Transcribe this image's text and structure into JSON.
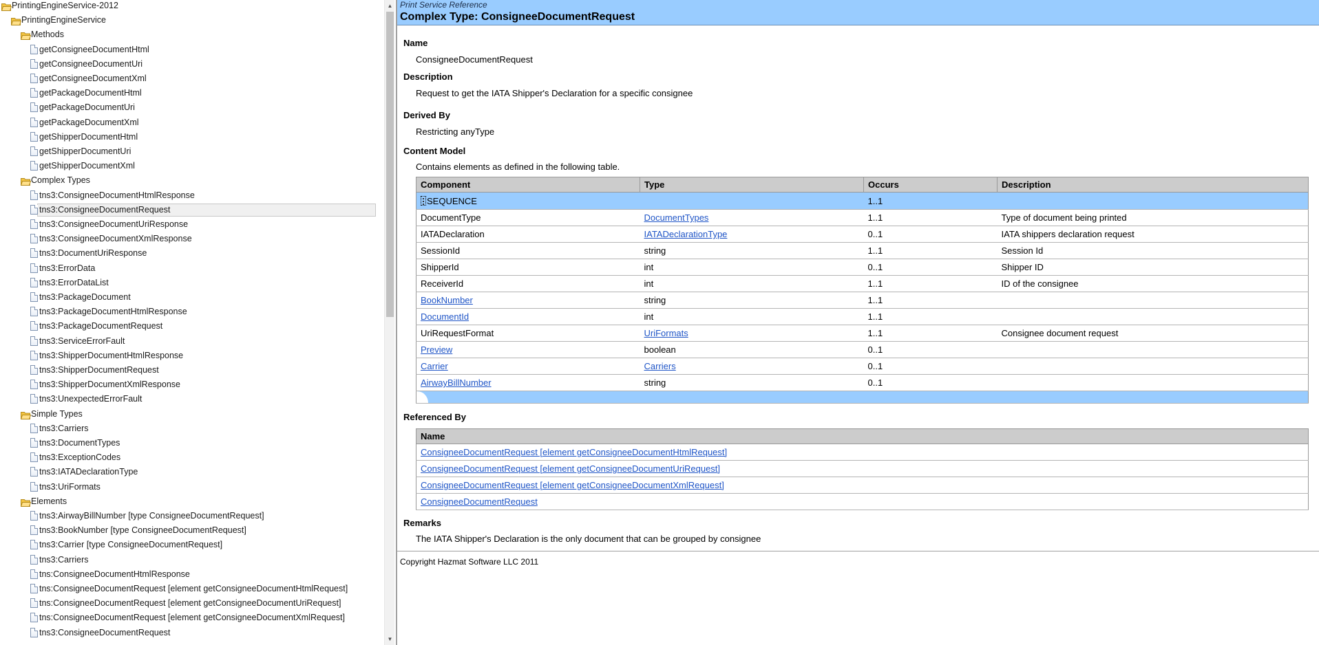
{
  "tree": {
    "items": [
      {
        "depth": 0,
        "kind": "folder",
        "label": "PrintingEngineService-2012"
      },
      {
        "depth": 1,
        "kind": "folder",
        "label": "PrintingEngineService"
      },
      {
        "depth": 2,
        "kind": "folder",
        "label": "Methods"
      },
      {
        "depth": 3,
        "kind": "doc",
        "label": "getConsigneeDocumentHtml"
      },
      {
        "depth": 3,
        "kind": "doc",
        "label": "getConsigneeDocumentUri"
      },
      {
        "depth": 3,
        "kind": "doc",
        "label": "getConsigneeDocumentXml"
      },
      {
        "depth": 3,
        "kind": "doc",
        "label": "getPackageDocumentHtml"
      },
      {
        "depth": 3,
        "kind": "doc",
        "label": "getPackageDocumentUri"
      },
      {
        "depth": 3,
        "kind": "doc",
        "label": "getPackageDocumentXml"
      },
      {
        "depth": 3,
        "kind": "doc",
        "label": "getShipperDocumentHtml"
      },
      {
        "depth": 3,
        "kind": "doc",
        "label": "getShipperDocumentUri"
      },
      {
        "depth": 3,
        "kind": "doc",
        "label": "getShipperDocumentXml"
      },
      {
        "depth": 2,
        "kind": "folder",
        "label": "Complex Types"
      },
      {
        "depth": 3,
        "kind": "doc",
        "label": "tns3:ConsigneeDocumentHtmlResponse"
      },
      {
        "depth": 3,
        "kind": "doc",
        "label": "tns3:ConsigneeDocumentRequest",
        "selected": true
      },
      {
        "depth": 3,
        "kind": "doc",
        "label": "tns3:ConsigneeDocumentUriResponse"
      },
      {
        "depth": 3,
        "kind": "doc",
        "label": "tns3:ConsigneeDocumentXmlResponse"
      },
      {
        "depth": 3,
        "kind": "doc",
        "label": "tns3:DocumentUriResponse"
      },
      {
        "depth": 3,
        "kind": "doc",
        "label": "tns3:ErrorData"
      },
      {
        "depth": 3,
        "kind": "doc",
        "label": "tns3:ErrorDataList"
      },
      {
        "depth": 3,
        "kind": "doc",
        "label": "tns3:PackageDocument"
      },
      {
        "depth": 3,
        "kind": "doc",
        "label": "tns3:PackageDocumentHtmlResponse"
      },
      {
        "depth": 3,
        "kind": "doc",
        "label": "tns3:PackageDocumentRequest"
      },
      {
        "depth": 3,
        "kind": "doc",
        "label": "tns3:ServiceErrorFault"
      },
      {
        "depth": 3,
        "kind": "doc",
        "label": "tns3:ShipperDocumentHtmlResponse"
      },
      {
        "depth": 3,
        "kind": "doc",
        "label": "tns3:ShipperDocumentRequest"
      },
      {
        "depth": 3,
        "kind": "doc",
        "label": "tns3:ShipperDocumentXmlResponse"
      },
      {
        "depth": 3,
        "kind": "doc",
        "label": "tns3:UnexpectedErrorFault"
      },
      {
        "depth": 2,
        "kind": "folder",
        "label": "Simple Types"
      },
      {
        "depth": 3,
        "kind": "doc",
        "label": "tns3:Carriers"
      },
      {
        "depth": 3,
        "kind": "doc",
        "label": "tns3:DocumentTypes"
      },
      {
        "depth": 3,
        "kind": "doc",
        "label": "tns3:ExceptionCodes"
      },
      {
        "depth": 3,
        "kind": "doc",
        "label": "tns3:IATADeclarationType"
      },
      {
        "depth": 3,
        "kind": "doc",
        "label": "tns3:UriFormats"
      },
      {
        "depth": 2,
        "kind": "folder",
        "label": "Elements"
      },
      {
        "depth": 3,
        "kind": "doc",
        "label": "tns3:AirwayBillNumber [type ConsigneeDocumentRequest]"
      },
      {
        "depth": 3,
        "kind": "doc",
        "label": "tns3:BookNumber [type ConsigneeDocumentRequest]"
      },
      {
        "depth": 3,
        "kind": "doc",
        "label": "tns3:Carrier [type ConsigneeDocumentRequest]"
      },
      {
        "depth": 3,
        "kind": "doc",
        "label": "tns3:Carriers"
      },
      {
        "depth": 3,
        "kind": "doc",
        "label": "tns:ConsigneeDocumentHtmlResponse"
      },
      {
        "depth": 3,
        "kind": "doc",
        "label": "tns:ConsigneeDocumentRequest [element getConsigneeDocumentHtmlRequest]"
      },
      {
        "depth": 3,
        "kind": "doc",
        "label": "tns:ConsigneeDocumentRequest [element getConsigneeDocumentUriRequest]"
      },
      {
        "depth": 3,
        "kind": "doc",
        "label": "tns:ConsigneeDocumentRequest [element getConsigneeDocumentXmlRequest]"
      },
      {
        "depth": 3,
        "kind": "doc",
        "label": "tns3:ConsigneeDocumentRequest"
      }
    ]
  },
  "header": {
    "eyebrow": "Print Service Reference",
    "title": "Complex Type: ConsigneeDocumentRequest"
  },
  "sections": {
    "name_heading": "Name",
    "name_value": "ConsigneeDocumentRequest",
    "description_heading": "Description",
    "description_value": "Request to get the IATA Shipper's Declaration for a specific consignee",
    "derived_heading": "Derived By",
    "derived_value": "Restricting anyType",
    "content_model_heading": "Content Model",
    "content_model_intro": "Contains elements as defined in the following table.",
    "referenced_by_heading": "Referenced By",
    "remarks_heading": "Remarks",
    "remarks_value": "The IATA Shipper's Declaration is the only document that can be grouped by consignee"
  },
  "content_model": {
    "columns": [
      "Component",
      "Type",
      "Occurs",
      "Description"
    ],
    "group": {
      "label": "SEQUENCE",
      "occurs": "1..1"
    },
    "rows": [
      {
        "component": "DocumentType",
        "component_link": false,
        "type": "DocumentTypes",
        "type_link": true,
        "occurs": "1..1",
        "description": "Type of document being printed"
      },
      {
        "component": "IATADeclaration",
        "component_link": false,
        "type": "IATADeclarationType",
        "type_link": true,
        "occurs": "0..1",
        "description": "IATA shippers declaration request"
      },
      {
        "component": "SessionId",
        "component_link": false,
        "type": "string",
        "type_link": false,
        "occurs": "1..1",
        "description": "Session Id"
      },
      {
        "component": "ShipperId",
        "component_link": false,
        "type": "int",
        "type_link": false,
        "occurs": "0..1",
        "description": "Shipper ID"
      },
      {
        "component": "ReceiverId",
        "component_link": false,
        "type": "int",
        "type_link": false,
        "occurs": "1..1",
        "description": "ID of the consignee"
      },
      {
        "component": "BookNumber",
        "component_link": true,
        "type": "string",
        "type_link": false,
        "occurs": "1..1",
        "description": ""
      },
      {
        "component": "DocumentId",
        "component_link": true,
        "type": "int",
        "type_link": false,
        "occurs": "1..1",
        "description": ""
      },
      {
        "component": "UriRequestFormat",
        "component_link": false,
        "type": "UriFormats",
        "type_link": true,
        "occurs": "1..1",
        "description": "Consignee document request"
      },
      {
        "component": "Preview",
        "component_link": true,
        "type": "boolean",
        "type_link": false,
        "occurs": "0..1",
        "description": ""
      },
      {
        "component": "Carrier",
        "component_link": true,
        "type": "Carriers",
        "type_link": true,
        "occurs": "0..1",
        "description": ""
      },
      {
        "component": "AirwayBillNumber",
        "component_link": true,
        "type": "string",
        "type_link": false,
        "occurs": "0..1",
        "description": ""
      }
    ]
  },
  "referenced_by": {
    "columns": [
      "Name"
    ],
    "rows": [
      "ConsigneeDocumentRequest [element getConsigneeDocumentHtmlRequest]",
      "ConsigneeDocumentRequest [element getConsigneeDocumentUriRequest]",
      "ConsigneeDocumentRequest [element getConsigneeDocumentXmlRequest]",
      "ConsigneeDocumentRequest"
    ]
  },
  "footer": {
    "copyright": "Copyright Hazmat Software LLC 2011"
  },
  "colors": {
    "header_bg": "#99ccff",
    "link": "#1f55c7",
    "table_header_bg": "#cccccc",
    "folder_yellow": "#f4c542"
  },
  "icons": {
    "folder": "folder-open-icon",
    "document": "document-icon"
  }
}
